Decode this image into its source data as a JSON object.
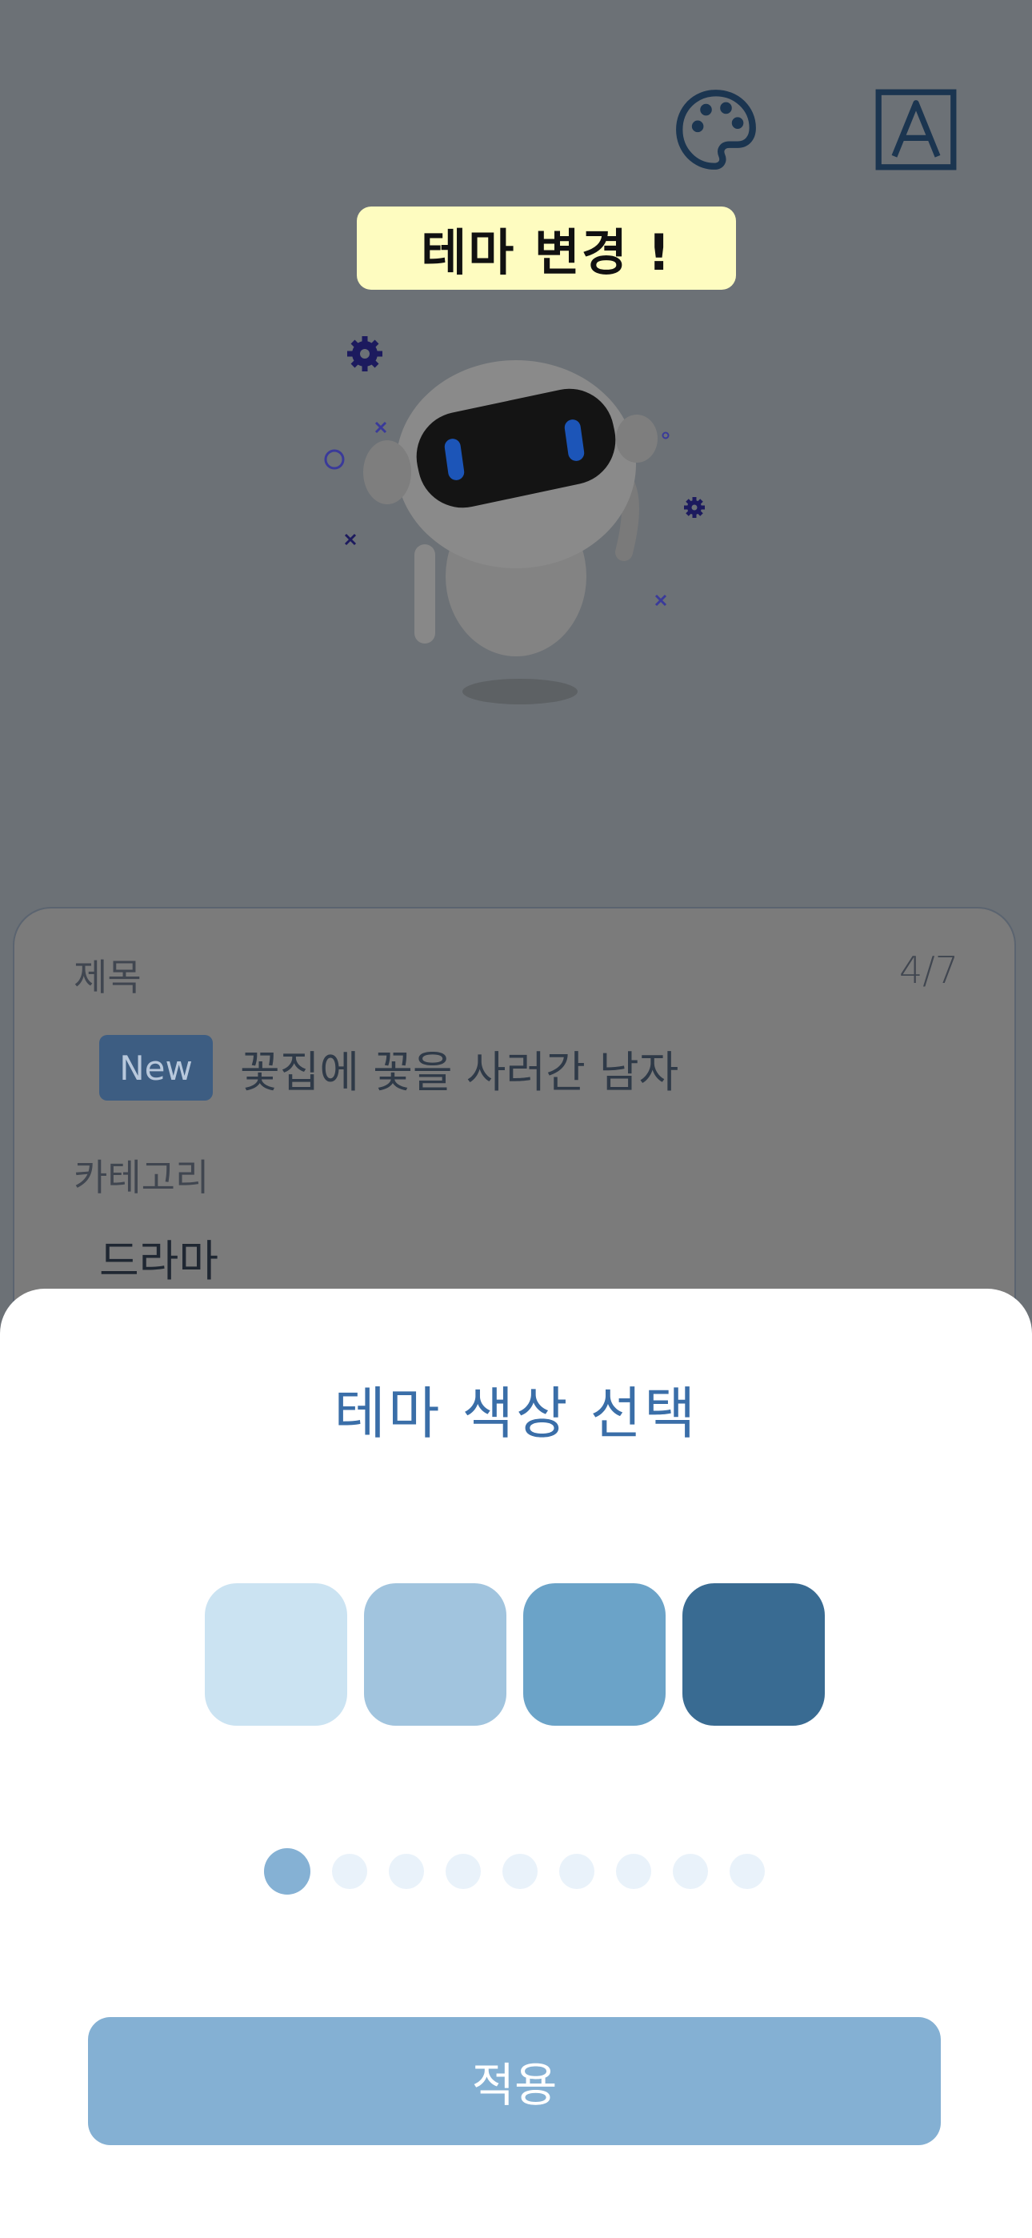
{
  "bubble": {
    "text": "테마 변경 !"
  },
  "card": {
    "title_label": "제목",
    "count": "4/7",
    "badge": "New",
    "title_value": "꽃집에 꽃을 사러간 남자",
    "category_label": "카테고리",
    "category_value": "드라마"
  },
  "sheet": {
    "title": "테마 색상 선택",
    "swatches": [
      "#cbe3f2",
      "#a1c4de",
      "#6ba3c8",
      "#396b92"
    ],
    "page_dots": {
      "count": 9,
      "active": 1
    },
    "apply_label": "적용"
  },
  "icons": {
    "palette": "palette-icon",
    "font": "font-icon",
    "robot": "robot-illustration"
  }
}
